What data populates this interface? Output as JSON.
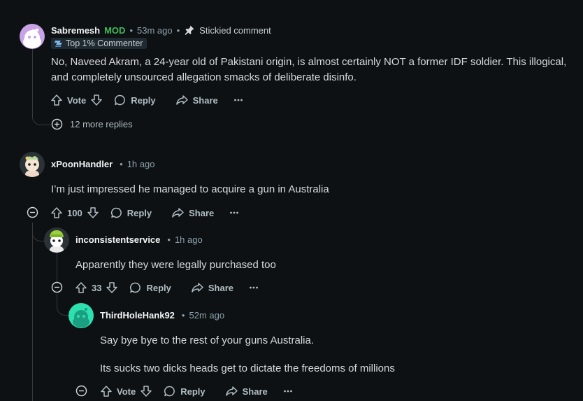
{
  "comments": [
    {
      "username": "Sabremesh",
      "mod_badge": "MOD",
      "time": "53m ago",
      "stickied": "Stickied comment",
      "flair": "Top 1% Commenter",
      "body": "No, Naveed Akram, a 24-year old of Pakistani origin, is almost certainly NOT a former IDF soldier. This illogical, and completely unsourced allegation smacks of deliberate disinfo.",
      "vote_label": "Vote",
      "reply_label": "Reply",
      "share_label": "Share",
      "more_replies": "12 more replies"
    },
    {
      "username": "xPoonHandler",
      "time": "1h ago",
      "body": "I’m just impressed he managed to acquire a gun in Australia",
      "votes": "100",
      "reply_label": "Reply",
      "share_label": "Share"
    },
    {
      "username": "inconsistentservice",
      "time": "1h ago",
      "body": "Apparently they were legally purchased too",
      "votes": "33",
      "reply_label": "Reply",
      "share_label": "Share"
    },
    {
      "username": "ThirdHoleHank92",
      "time": "52m ago",
      "body_lines": [
        "Say bye bye to the rest of your guns Australia.",
        "Its sucks two dicks heads get to dictate the freedoms of millions"
      ],
      "vote_label": "Vote",
      "reply_label": "Reply",
      "share_label": "Share"
    }
  ],
  "icons": {
    "more": "ellipsis-icon",
    "upvote": "arrow-up-icon",
    "downvote": "arrow-down-icon",
    "reply": "speech-bubble-icon",
    "share": "share-arrow-icon",
    "pin": "pin-icon",
    "collapse": "minus-circle-icon",
    "expand": "plus-circle-icon"
  },
  "colors": {
    "background": "#0e1113",
    "mod_green": "#3fbd5a",
    "meta_text": "#8ba2ad"
  }
}
